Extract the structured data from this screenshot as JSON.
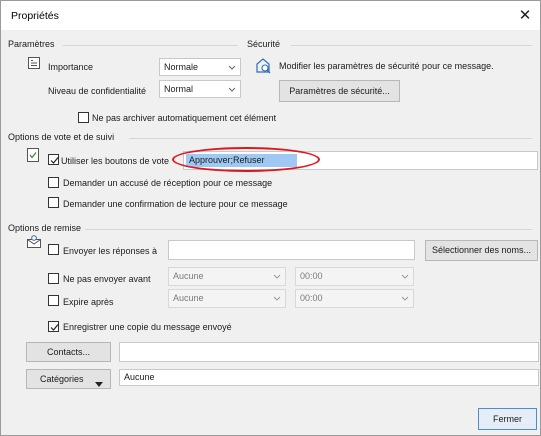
{
  "window": {
    "title": "Propriétés",
    "close_label": "✕"
  },
  "parametres": {
    "heading": "Paramètres",
    "importance_label": "Importance",
    "importance_value": "Normale",
    "confidentialite_label": "Niveau de confidentialité",
    "confidentialite_value": "Normal",
    "ne_pas_archiver_label": "Ne pas archiver automatiquement cet élément",
    "ne_pas_archiver_checked": false
  },
  "securite": {
    "heading": "Sécurité",
    "text": "Modifier les paramètres de sécurité pour ce message.",
    "button_label": "Paramètres de sécurité..."
  },
  "vote": {
    "heading": "Options de vote et de suivi",
    "use_vote_label": "Utiliser les boutons de vote",
    "use_vote_checked": true,
    "vote_value": "Approuver;Refuser",
    "accuse_reception_label": "Demander un accusé de réception pour ce message",
    "accuse_reception_checked": false,
    "confirmation_lecture_label": "Demander une confirmation de lecture pour ce message",
    "confirmation_lecture_checked": false
  },
  "remise": {
    "heading": "Options de remise",
    "envoyer_reponses_label": "Envoyer les réponses à",
    "envoyer_reponses_checked": false,
    "envoyer_reponses_value": "",
    "selectionner_noms_label": "Sélectionner des noms...",
    "ne_pas_envoyer_label": "Ne pas envoyer avant",
    "ne_pas_envoyer_checked": false,
    "ne_pas_envoyer_date": "Aucune",
    "ne_pas_envoyer_time": "00:00",
    "expire_label": "Expire après",
    "expire_checked": false,
    "expire_date": "Aucune",
    "expire_time": "00:00",
    "enregistrer_copie_label": "Enregistrer une copie du message envoyé",
    "enregistrer_copie_checked": true
  },
  "footer": {
    "contacts_label": "Contacts...",
    "contacts_value": "",
    "categories_label": "Catégories",
    "categories_value": "Aucune",
    "fermer_label": "Fermer"
  },
  "colors": {
    "annotation_ellipse": "#e0161c",
    "selection_highlight": "#9fc9f2",
    "primary_button_border": "#4a8fd6"
  },
  "icons": {
    "importance": "flag-icon",
    "securite": "security-lock-icon",
    "vote": "vote-icon",
    "remise": "delivery-icon",
    "dropdown": "chevron-down-icon",
    "categories": "caret-down-icon"
  }
}
